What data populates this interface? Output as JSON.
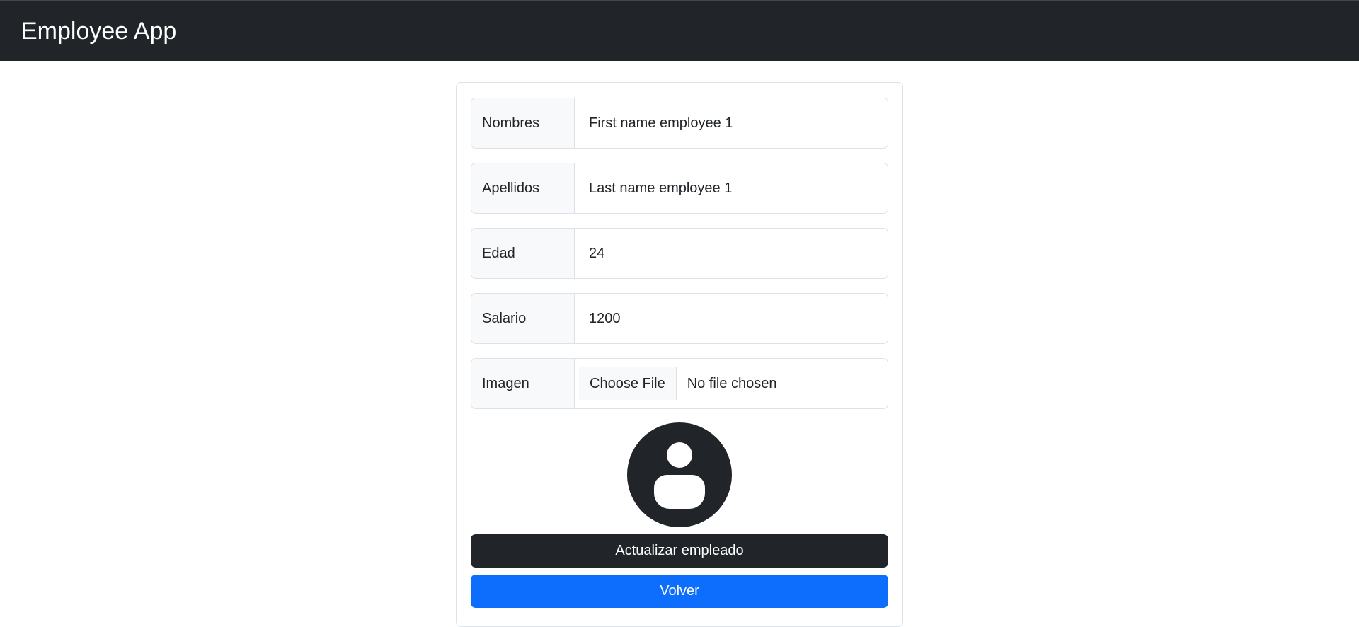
{
  "app": {
    "title": "Employee App"
  },
  "form": {
    "fields": [
      {
        "label": "Nombres",
        "value": "First name employee 1"
      },
      {
        "label": "Apellidos",
        "value": "Last name employee 1"
      },
      {
        "label": "Edad",
        "value": "24"
      },
      {
        "label": "Salario",
        "value": "1200"
      }
    ],
    "image_field": {
      "label": "Imagen",
      "button_label": "Choose File",
      "status": "No file chosen"
    },
    "avatar_icon": "user-avatar-icon",
    "update_button": "Actualizar empleado",
    "back_button": "Volver"
  },
  "colors": {
    "navbar": "#212529",
    "update_button": "#212529",
    "back_button": "#0d6efd",
    "input_label_bg": "#f8f9fa"
  }
}
